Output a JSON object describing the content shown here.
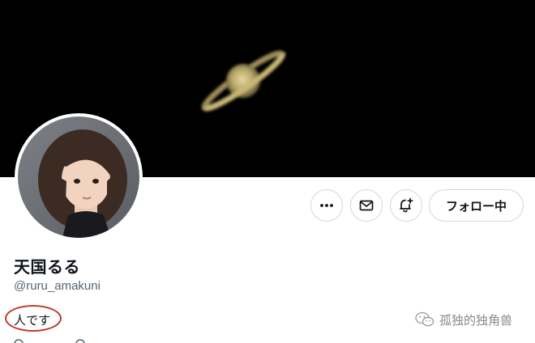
{
  "profile": {
    "display_name": "天国るる",
    "handle": "@ruru_amakuni",
    "bio": "人です"
  },
  "actions": {
    "more_label": "More",
    "message_label": "Message",
    "notify_label": "Notifications",
    "follow_label": "フォロー中"
  },
  "banner": {
    "subject": "saturn-image"
  },
  "watermark": {
    "text": "孤独的独角兽",
    "icon": "wechat-icon"
  },
  "colors": {
    "annotation": "#c0392b",
    "border": "#cfd9de",
    "secondary_text": "#536471"
  }
}
